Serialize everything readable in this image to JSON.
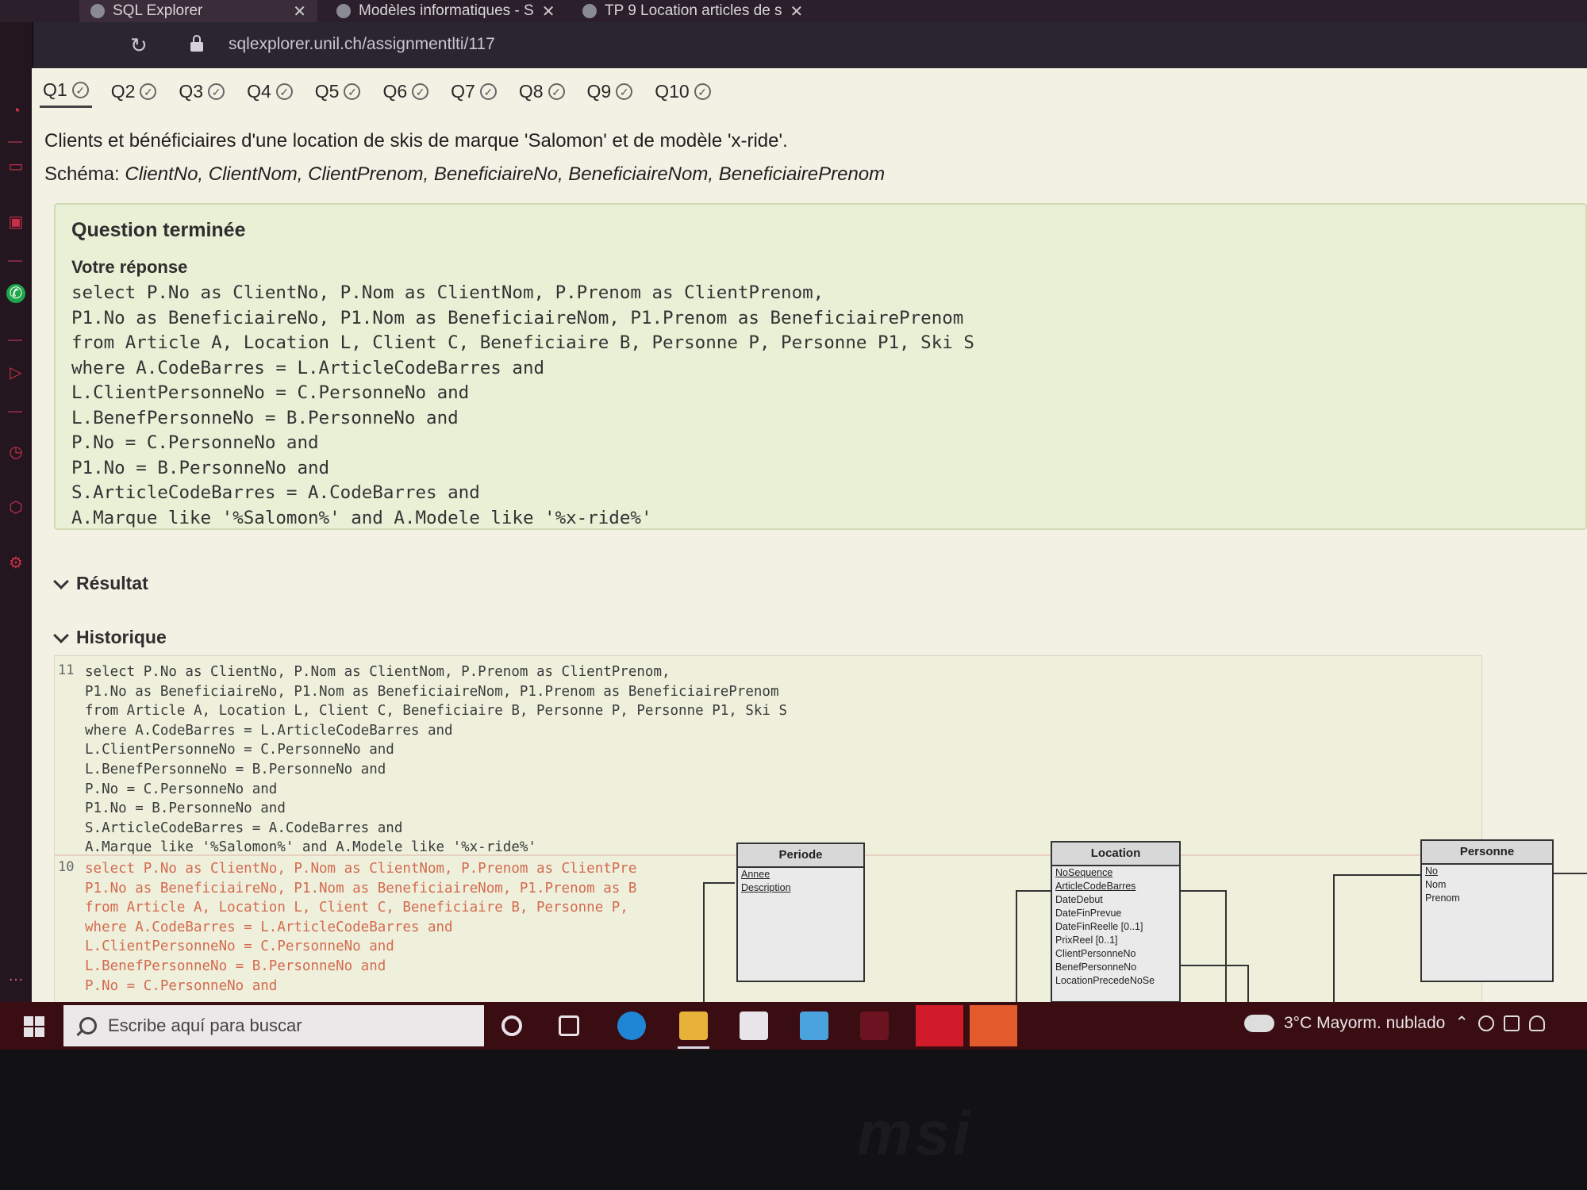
{
  "browser": {
    "tabs": [
      {
        "label": "SQL Explorer",
        "active": true
      },
      {
        "label": "Modèles informatiques - S",
        "active": false
      },
      {
        "label": "TP 9 Location articles de s",
        "active": false
      }
    ],
    "url": "sqlexplorer.unil.ch/assignmentlti/117"
  },
  "questions": {
    "tabs": [
      "Q1",
      "Q2",
      "Q3",
      "Q4",
      "Q5",
      "Q6",
      "Q7",
      "Q8",
      "Q9",
      "Q10"
    ],
    "active_index": 0
  },
  "exercise": {
    "statement": "Clients et bénéficiaires d'une location de skis de marque 'Salomon' et de modèle 'x-ride'.",
    "schema_label": "Schéma:",
    "schema_fields": "ClientNo, ClientNom, ClientPrenom, BeneficiaireNo, BeneficiaireNom, BeneficiairePrenom"
  },
  "answer": {
    "title": "Question terminée",
    "subtitle": "Votre réponse",
    "sql": "select P.No as ClientNo, P.Nom as ClientNom, P.Prenom as ClientPrenom,\nP1.No as BeneficiaireNo, P1.Nom as BeneficiaireNom, P1.Prenom as BeneficiairePrenom\nfrom Article A, Location L, Client C, Beneficiaire B, Personne P, Personne P1, Ski S\nwhere A.CodeBarres = L.ArticleCodeBarres and\nL.ClientPersonneNo = C.PersonneNo and\nL.BenefPersonneNo = B.PersonneNo and\nP.No = C.PersonneNo and\nP1.No = B.PersonneNo and\nS.ArticleCodeBarres = A.CodeBarres and\nA.Marque like '%Salomon%' and A.Modele like '%x-ride%'"
  },
  "sections": {
    "result": "Résultat",
    "history": "Historique"
  },
  "history": [
    {
      "number": "11",
      "sql": "select P.No as ClientNo, P.Nom as ClientNom, P.Prenom as ClientPrenom,\nP1.No as BeneficiaireNo, P1.Nom as BeneficiaireNom, P1.Prenom as BeneficiairePrenom\nfrom Article A, Location L, Client C, Beneficiaire B, Personne P, Personne P1, Ski S\nwhere A.CodeBarres = L.ArticleCodeBarres and\nL.ClientPersonneNo = C.PersonneNo and\nL.BenefPersonneNo = B.PersonneNo and\nP.No = C.PersonneNo and\nP1.No = B.PersonneNo and\nS.ArticleCodeBarres = A.CodeBarres and\nA.Marque like '%Salomon%' and A.Modele like '%x-ride%'"
    },
    {
      "number": "10",
      "sql": "select P.No as ClientNo, P.Nom as ClientNom, P.Prenom as ClientPre\nP1.No as BeneficiaireNo, P1.Nom as BeneficiaireNom, P1.Prenom as B\nfrom Article A, Location L, Client C, Beneficiaire B, Personne P,\nwhere A.CodeBarres = L.ArticleCodeBarres and\nL.ClientPersonneNo = C.PersonneNo and\nL.BenefPersonneNo = B.PersonneNo and\nP.No = C.PersonneNo and"
    }
  ],
  "diagram": {
    "periode": {
      "title": "Periode",
      "attrs": [
        "Annee",
        "Description"
      ]
    },
    "location": {
      "title": "Location",
      "attrs": [
        "NoSequence",
        "ArticleCodeBarres",
        "DateDebut",
        "DateFinPrevue",
        "DateFinReelle [0..1]",
        "PrixReel [0..1]",
        "ClientPersonneNo",
        "BenefPersonneNo",
        "LocationPrecedeNoSe"
      ]
    },
    "personne": {
      "title": "Personne",
      "attrs": [
        "No",
        "Nom",
        "Prenom"
      ]
    }
  },
  "taskbar": {
    "search_placeholder": "Escribe aquí para buscar",
    "weather": "3°C  Mayorm. nublado"
  },
  "bezel": {
    "brand": "msi"
  }
}
